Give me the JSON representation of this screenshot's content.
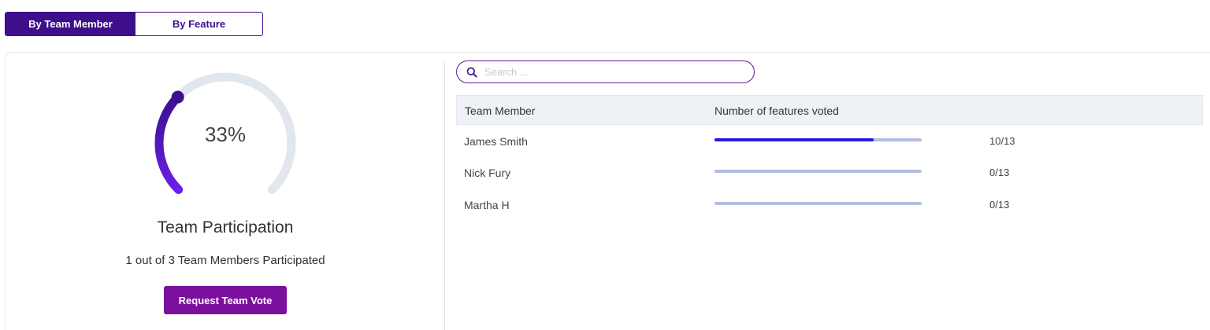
{
  "toggle": {
    "active_label": "By Team Member",
    "inactive_label": "By Feature"
  },
  "participation": {
    "percent": 33,
    "percent_label": "33%",
    "title": "Team Participation",
    "subtitle": "1 out of 3 Team Members Participated",
    "button_label": "Request Team Vote",
    "colors": {
      "track": "#e2e6ed",
      "arc_start": "#3d0f8c",
      "arc_end": "#6a1fe8"
    }
  },
  "search": {
    "placeholder": "Search ...",
    "icon": "search-icon"
  },
  "table": {
    "headers": {
      "member": "Team Member",
      "votes": "Number of features voted"
    },
    "rows": [
      {
        "name": "James Smith",
        "voted": 10,
        "total": 13,
        "label": "10/13"
      },
      {
        "name": "Nick Fury",
        "voted": 0,
        "total": 13,
        "label": "0/13"
      },
      {
        "name": "Martha H",
        "voted": 0,
        "total": 13,
        "label": "0/13"
      }
    ]
  },
  "colors": {
    "primary": "#3d0f8c",
    "button": "#7b0f9e",
    "bar_fill": "#2a17d6",
    "bar_track": "#b4bde0"
  }
}
